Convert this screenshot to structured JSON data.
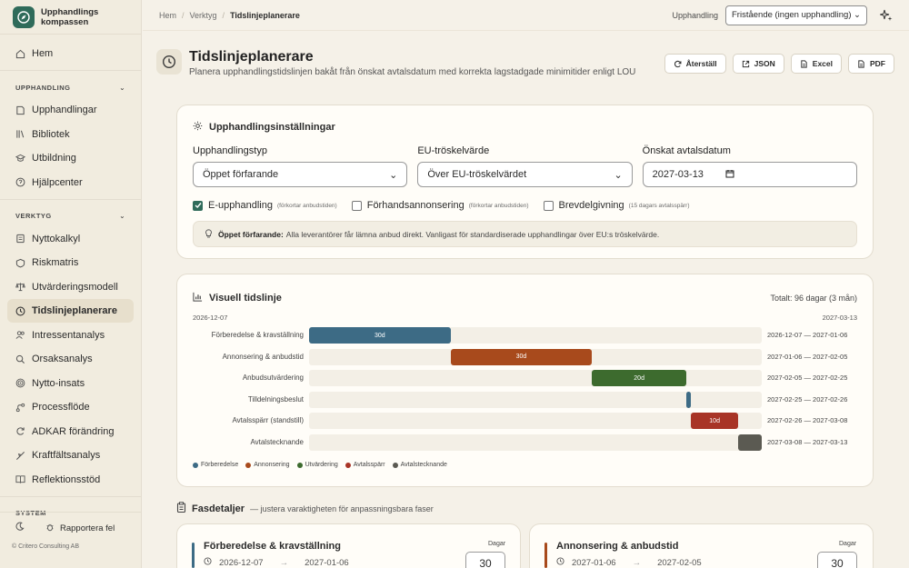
{
  "brand": {
    "line1": "Upphandlings",
    "line2": "kompassen",
    "color": "#2f6b5a"
  },
  "sidebar": {
    "home": "Hem",
    "section_upphandling": "UPPHANDLING",
    "upphandling_items": [
      "Upphandlingar",
      "Bibliotek",
      "Utbildning",
      "Hjälpcenter"
    ],
    "section_verktyg": "VERKTYG",
    "verktyg_items": [
      "Nyttokalkyl",
      "Riskmatris",
      "Utvärderingsmodell",
      "Tidslinjeplanerare",
      "Intressentanalys",
      "Orsaksanalys",
      "Nytto-insats",
      "Processflöde",
      "ADKAR förändring",
      "Kraftfältsanalys",
      "Reflektionsstöd"
    ],
    "active": "Tidslinjeplanerare",
    "section_system": "SYSTEM",
    "report_bug": "Rapportera fel",
    "copyright": "© Critero Consulting AB"
  },
  "topbar": {
    "crumbs": [
      "Hem",
      "Verktyg",
      "Tidslinjeplanerare"
    ],
    "procurement_label": "Upphandling",
    "procurement_value": "Fristående (ingen upphandling)"
  },
  "header": {
    "title": "Tidslinjeplanerare",
    "subtitle": "Planera upphandlingstidslinjen bakåt från önskat avtalsdatum med korrekta lagstadgade minimitider enligt LOU",
    "actions": [
      "Återställ",
      "JSON",
      "Excel",
      "PDF"
    ]
  },
  "settings": {
    "title": "Upphandlingsinställningar",
    "type_label": "Upphandlingstyp",
    "type_value": "Öppet förfarande",
    "threshold_label": "EU-tröskelvärde",
    "threshold_value": "Över EU-tröskelvärdet",
    "date_label": "Önskat avtalsdatum",
    "date_value": "2027-03-13",
    "checks": [
      {
        "label": "E-upphandling",
        "note": "(förkortar anbudstiden)",
        "checked": true
      },
      {
        "label": "Förhandsannonsering",
        "note": "(förkortar anbudstiden)",
        "checked": false
      },
      {
        "label": "Brevdelgivning",
        "note": "(15 dagars avtalsspärr)",
        "checked": false
      }
    ],
    "info_bold": "Öppet förfarande:",
    "info_text": "Alla leverantörer får lämna anbud direkt. Vanligast för standardiserade upphandlingar över EU:s tröskelvärde."
  },
  "timeline": {
    "title": "Visuell tidslinje",
    "total": "Totalt: 96 dagar (3 mån)",
    "start_label": "2026-12-07",
    "end_label": "2027-03-13"
  },
  "chart_data": {
    "type": "bar",
    "start": "2026-12-07",
    "end": "2027-03-13",
    "total_days": 96,
    "rows": [
      {
        "label": "Förberedelse & kravställning",
        "start": "2026-12-07",
        "end": "2027-01-06",
        "days": 30,
        "bar_text": "30d",
        "range": "2026-12-07 — 2027-01-06",
        "color": "#3d6b85"
      },
      {
        "label": "Annonsering & anbudstid",
        "start": "2027-01-06",
        "end": "2027-02-05",
        "days": 30,
        "bar_text": "30d",
        "range": "2027-01-06 — 2027-02-05",
        "color": "#a84a1c"
      },
      {
        "label": "Anbudsutvärdering",
        "start": "2027-02-05",
        "end": "2027-02-25",
        "days": 20,
        "bar_text": "20d",
        "range": "2027-02-05 — 2027-02-25",
        "color": "#3d6b2e"
      },
      {
        "label": "Tilldelningsbeslut",
        "start": "2027-02-25",
        "end": "2027-02-26",
        "days": 1,
        "bar_text": "",
        "range": "2027-02-25 — 2027-02-26",
        "color": "#3d6b85"
      },
      {
        "label": "Avtalsspärr (standstill)",
        "start": "2027-02-26",
        "end": "2027-03-08",
        "days": 10,
        "bar_text": "10d",
        "range": "2027-02-26 — 2027-03-08",
        "color": "#a83426"
      },
      {
        "label": "Avtalstecknande",
        "start": "2027-03-08",
        "end": "2027-03-13",
        "days": 5,
        "bar_text": "",
        "range": "2027-03-08 — 2027-03-13",
        "color": "#5b5a52"
      }
    ],
    "legend": [
      {
        "name": "Förberedelse",
        "color": "#3d6b85"
      },
      {
        "name": "Annonsering",
        "color": "#a84a1c"
      },
      {
        "name": "Utvärdering",
        "color": "#3d6b2e"
      },
      {
        "name": "Avtalsspärr",
        "color": "#a83426"
      },
      {
        "name": "Avtalstecknande",
        "color": "#5b5a52"
      }
    ]
  },
  "phases": {
    "title": "Fasdetaljer",
    "subtitle": "— justera varaktigheten för anpassningsbara faser",
    "days_label": "Dagar",
    "cards": [
      {
        "name": "Förberedelse & kravställning",
        "start": "2026-12-07",
        "end": "2027-01-06",
        "days": "30",
        "color": "#3d6b85"
      },
      {
        "name": "Annonsering & anbudstid",
        "start": "2027-01-06",
        "end": "2027-02-05",
        "days": "30",
        "color": "#a84a1c"
      }
    ]
  }
}
